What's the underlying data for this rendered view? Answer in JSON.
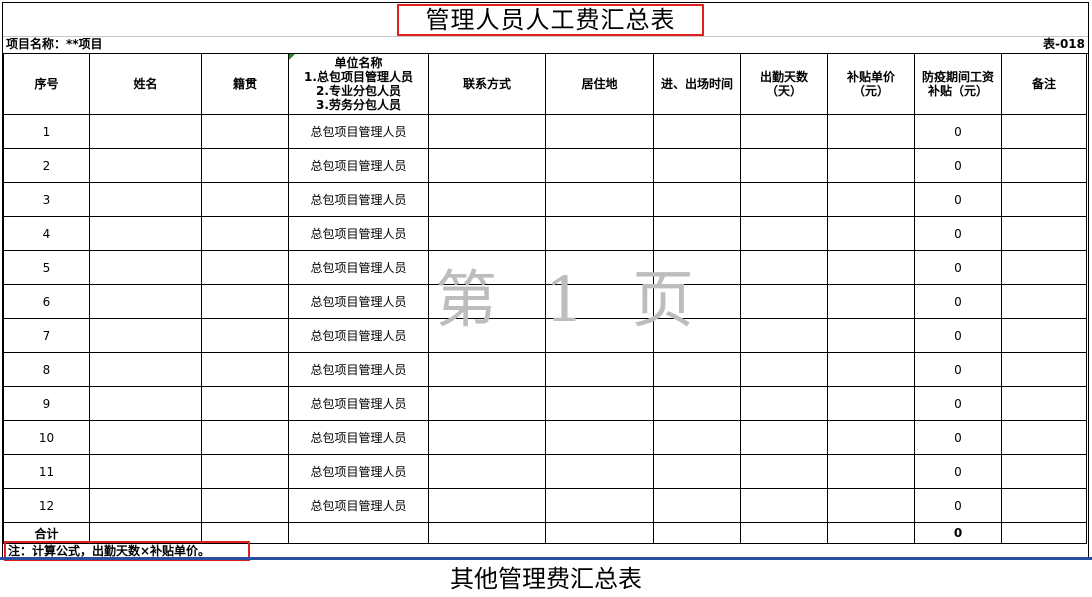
{
  "title": "管理人员人工费汇总表",
  "project_label": "项目名称：**项目",
  "table_code": "表-018",
  "headers": {
    "seq": "序号",
    "name": "姓名",
    "origin": "籍贯",
    "unit_title": "单位名称",
    "unit_opt1": "1.总包项目管理人员",
    "unit_opt2": "2.专业分包人员",
    "unit_opt3": "3.劳务分包人员",
    "contact": "联系方式",
    "residence": "居住地",
    "in_out_time": "进、出场时间",
    "days": "出勤天数（天）",
    "unit_price": "补贴单价（元）",
    "subsidy": "防疫期间工资补贴（元）",
    "remark": "备注"
  },
  "rows": [
    {
      "seq": "1",
      "unit": "总包项目管理人员",
      "subsidy": "0"
    },
    {
      "seq": "2",
      "unit": "总包项目管理人员",
      "subsidy": "0"
    },
    {
      "seq": "3",
      "unit": "总包项目管理人员",
      "subsidy": "0"
    },
    {
      "seq": "4",
      "unit": "总包项目管理人员",
      "subsidy": "0"
    },
    {
      "seq": "5",
      "unit": "总包项目管理人员",
      "subsidy": "0"
    },
    {
      "seq": "6",
      "unit": "总包项目管理人员",
      "subsidy": "0"
    },
    {
      "seq": "7",
      "unit": "总包项目管理人员",
      "subsidy": "0"
    },
    {
      "seq": "8",
      "unit": "总包项目管理人员",
      "subsidy": "0"
    },
    {
      "seq": "9",
      "unit": "总包项目管理人员",
      "subsidy": "0"
    },
    {
      "seq": "10",
      "unit": "总包项目管理人员",
      "subsidy": "0"
    },
    {
      "seq": "11",
      "unit": "总包项目管理人员",
      "subsidy": "0"
    },
    {
      "seq": "12",
      "unit": "总包项目管理人员",
      "subsidy": "0"
    }
  ],
  "total": {
    "label": "合计",
    "subsidy": "0"
  },
  "note": "注：计算公式，出勤天数×补贴单价。",
  "watermark": "第 1 页",
  "next_title": "其他管理费汇总表"
}
